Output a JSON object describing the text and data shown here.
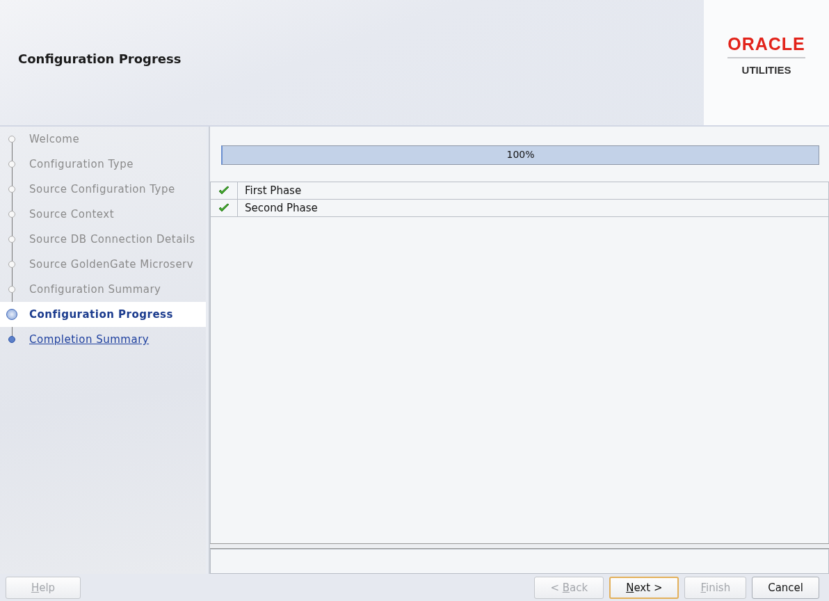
{
  "header": {
    "title": "Configuration Progress",
    "logo": {
      "brand": "ORACLE",
      "product": "UTILITIES"
    }
  },
  "steps": [
    {
      "label": "Welcome",
      "visited": true,
      "selected": false
    },
    {
      "label": "Configuration Type",
      "visited": true,
      "selected": false
    },
    {
      "label": "Source Configuration Type",
      "visited": true,
      "selected": false
    },
    {
      "label": "Source Context",
      "visited": true,
      "selected": false
    },
    {
      "label": "Source DB Connection Details",
      "visited": true,
      "selected": false
    },
    {
      "label": "Source GoldenGate Microserv",
      "visited": true,
      "selected": false
    },
    {
      "label": "Configuration Summary",
      "visited": true,
      "selected": false
    },
    {
      "label": "Configuration Progress",
      "visited": true,
      "selected": true
    },
    {
      "label": "Completion Summary",
      "visited": false,
      "selected": false
    }
  ],
  "progress": {
    "level": 1,
    "reading": "100%"
  },
  "phases": [
    {
      "name": "First Phase",
      "succeeded": true
    },
    {
      "name": "Second Phase",
      "succeeded": true
    }
  ],
  "buttons": [
    {
      "mnemonic": "H",
      "after": "elp",
      "disabled": true,
      "default": false,
      "separate": true
    },
    {
      "before": "< ",
      "mnemonic": "B",
      "after": "ack",
      "disabled": true,
      "default": false,
      "separate": false
    },
    {
      "mnemonic": "N",
      "after": "ext >",
      "disabled": false,
      "default": true,
      "separate": false
    },
    {
      "mnemonic": "F",
      "after": "inish",
      "disabled": true,
      "default": false,
      "separate": false
    },
    {
      "before": "Cancel",
      "disabled": false,
      "default": false,
      "separate": false
    }
  ]
}
